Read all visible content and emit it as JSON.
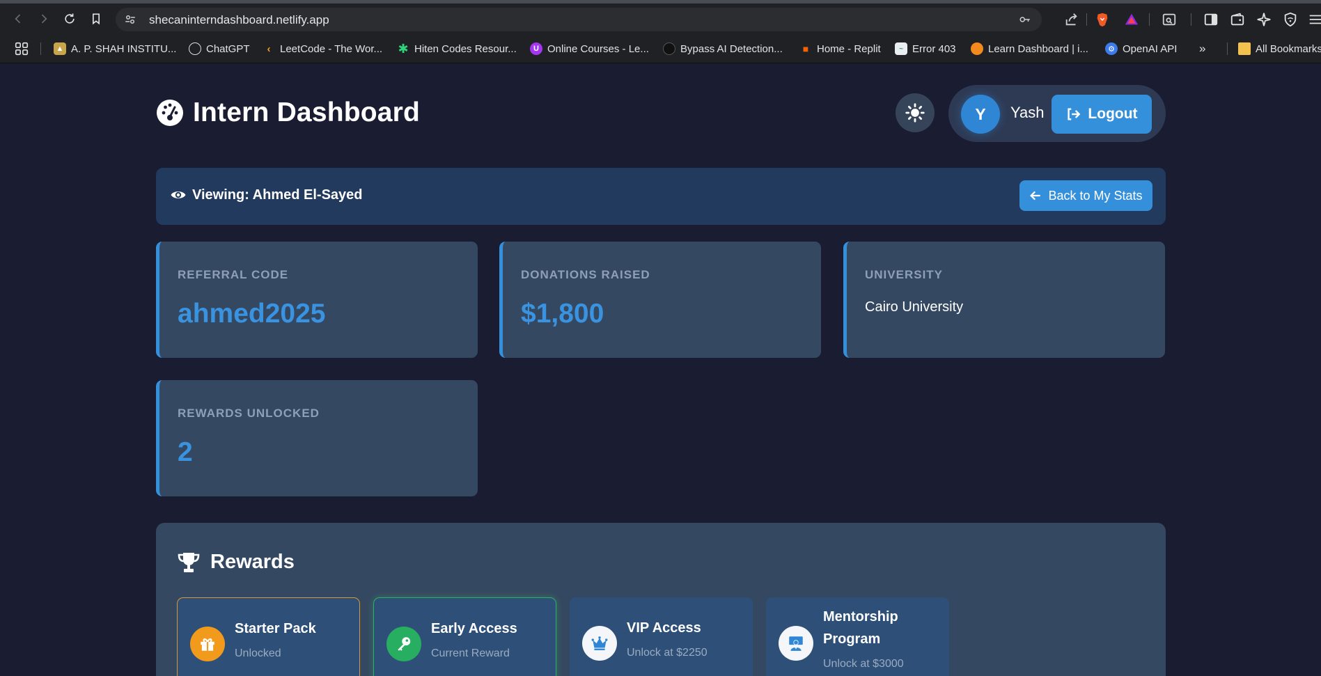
{
  "browser": {
    "url": "shecaninterndashboard.netlify.app",
    "bookmarks": [
      {
        "label": "A. P. SHAH INSTITU...",
        "icon": "institute-logo-icon"
      },
      {
        "label": "ChatGPT",
        "icon": "chatgpt-icon"
      },
      {
        "label": "LeetCode - The Wor...",
        "icon": "leetcode-icon"
      },
      {
        "label": "Hiten Codes Resour...",
        "icon": "asterisk-icon"
      },
      {
        "label": "Online Courses - Le...",
        "icon": "udemy-icon"
      },
      {
        "label": "Bypass AI Detection...",
        "icon": "globe-icon"
      },
      {
        "label": "Home - Replit",
        "icon": "replit-icon"
      },
      {
        "label": "Error 403",
        "icon": "error-page-icon"
      },
      {
        "label": "Learn Dashboard | i...",
        "icon": "learn-icon"
      },
      {
        "label": "OpenAI API",
        "icon": "openai-icon"
      }
    ],
    "more_label": "»",
    "all_bookmarks": "All Bookmarks"
  },
  "header": {
    "title": "Intern Dashboard",
    "user_initial": "Y",
    "user_name": "Yash",
    "logout_label": "Logout"
  },
  "viewing": {
    "label": "Viewing: Ahmed El-Sayed",
    "back_label": "Back to My Stats"
  },
  "stats": {
    "referral": {
      "label": "REFERRAL CODE",
      "value": "ahmed2025"
    },
    "donations": {
      "label": "DONATIONS RAISED",
      "value": "$1,800"
    },
    "university": {
      "label": "UNIVERSITY",
      "value": "Cairo University"
    },
    "rewards": {
      "label": "REWARDS UNLOCKED",
      "value": "2"
    }
  },
  "rewards": {
    "title": "Rewards",
    "items": [
      {
        "name": "Starter Pack",
        "status": "Unlocked",
        "icon": "gift-icon"
      },
      {
        "name": "Early Access",
        "status": "Current Reward",
        "icon": "key-icon"
      },
      {
        "name": "VIP Access",
        "status": "Unlock at $2250",
        "icon": "crown-icon"
      },
      {
        "name": "Mentorship Program",
        "name_line1": "Mentorship",
        "name_line2": "Program",
        "status": "Unlock at $3000",
        "icon": "mentor-icon"
      }
    ]
  },
  "colors": {
    "background": "#1a1c32",
    "card": "#354861",
    "accent": "#3590dc",
    "unlocked_border": "#d99a2b",
    "current_border": "#2fb163"
  }
}
